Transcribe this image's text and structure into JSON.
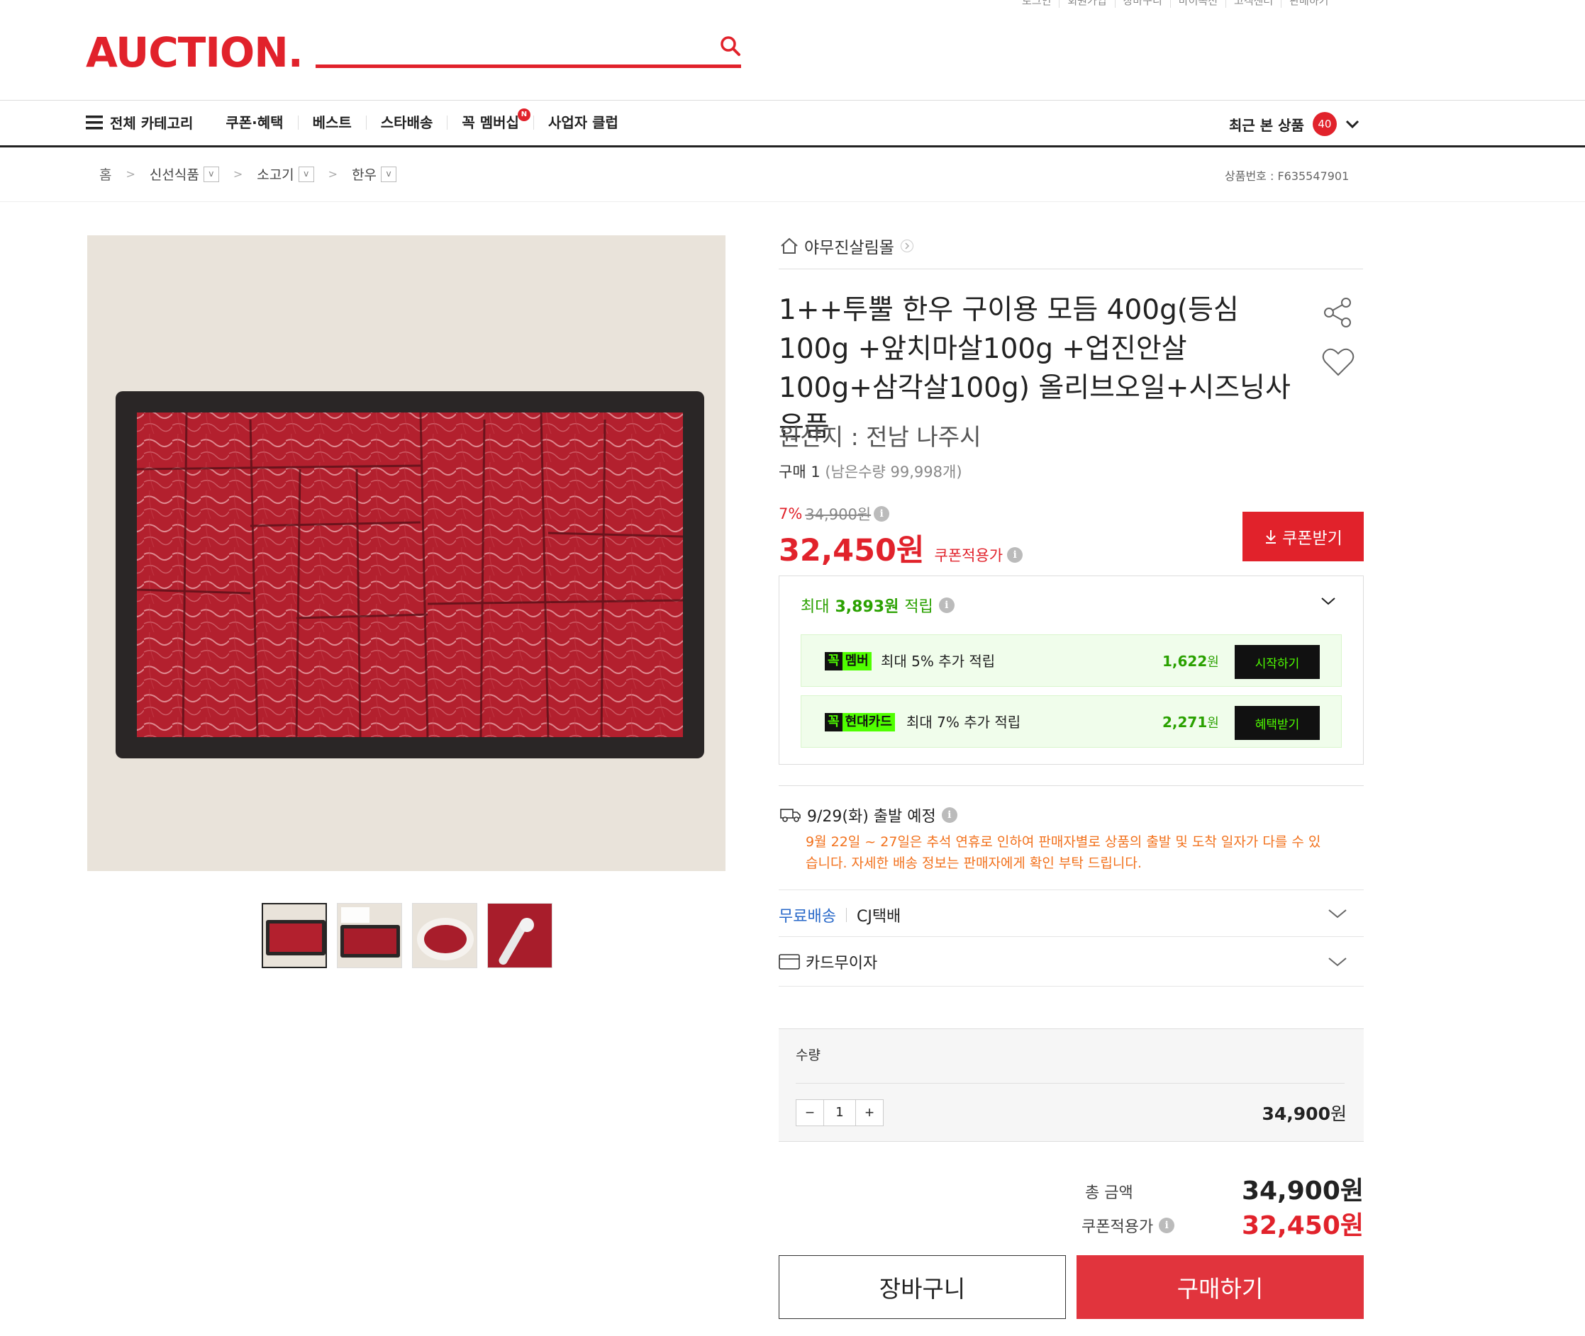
{
  "header": {
    "top_links": [
      "로그인",
      "회원가입",
      "장바구니",
      "마이옥션",
      "고객센터",
      "판매하기"
    ],
    "logo": "AUCTION.",
    "search_placeholder": ""
  },
  "nav": {
    "category_label": "전체 카테고리",
    "items": [
      "쿠폰·혜택",
      "베스트",
      "스타배송",
      "꼭 멤버십",
      "사업자 클럽"
    ],
    "new_badge": "N",
    "recent_label": "최근 본 상품",
    "recent_count": "40"
  },
  "breadcrumb": {
    "home": "홈",
    "items": [
      "신선식품",
      "소고기",
      "한우"
    ]
  },
  "product_code": "상품번호 : F635547901",
  "seller": "야무진살림몰",
  "product": {
    "title": "1++투뿔 한우 구이용 모듬 400g(등심100g +앞치마살100g +업진안살100g+삼각살100g) 올리브오일+시즈닝사은품",
    "origin": "원산지 : 전남 나주시",
    "buy_count": "구매 1",
    "remaining": "(남은수량 99,998개)",
    "discount_pct": "7%",
    "original_price": "34,900원",
    "price": "32,450원",
    "price_label": "쿠폰적용가",
    "coupon_button": "쿠폰받기"
  },
  "reward": {
    "head_prefix": "최대",
    "head_amount": "3,893원",
    "head_suffix": "적립",
    "rows": [
      {
        "tag_k": "꼭",
        "tag_name": "멤버",
        "desc": "최대 5% 추가 적립",
        "amount": "1,622",
        "unit": "원",
        "action": "시작하기"
      },
      {
        "tag_k": "꼭",
        "tag_name": "현대카드",
        "desc": "최대 7% 추가 적립",
        "amount": "2,271",
        "unit": "원",
        "action": "혜택받기"
      }
    ]
  },
  "shipping": {
    "departure": "9/29(화) 출발 예정",
    "note": "9월 22일 ~ 27일은 추석 연휴로 인하여 판매자별로 상품의 출발 및 도착 일자가 다를 수 있습니다. 자세한 배송 정보는 판매자에게 확인 부탁 드립니다.",
    "free_label": "무료배송",
    "carrier": "CJ택배",
    "card_label": "카드무이자"
  },
  "quantity": {
    "label": "수량",
    "value": "1",
    "minus": "−",
    "plus": "+",
    "price": "34,900",
    "unit": "원"
  },
  "totals": {
    "total_label": "총 금액",
    "total_value": "34,900원",
    "coupon_label": "쿠폰적용가",
    "coupon_value": "32,450원"
  },
  "buttons": {
    "cart": "장바구니",
    "buy": "구매하기"
  },
  "colors": {
    "brand_red": "#e1222b",
    "reward_green": "#2aa100",
    "link_blue": "#2868c9",
    "notice_orange": "#f2711c"
  }
}
